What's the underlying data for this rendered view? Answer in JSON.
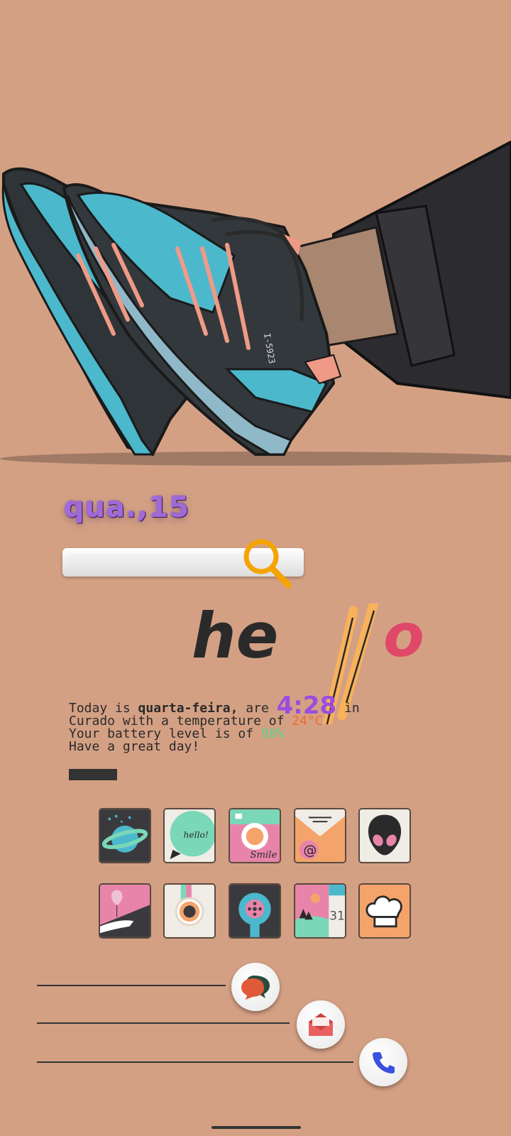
{
  "date_widget": {
    "text": "qua.,15"
  },
  "greeting": {
    "letters": "he",
    "tail": "o"
  },
  "info": {
    "line1_prefix": "Today is ",
    "weekday": "quarta-feira,",
    "line1_mid": " are ",
    "time": "4:28",
    "line1_suffix": " in",
    "line2_prefix": "Curado with a temperature of ",
    "temperature": "24°C",
    "line3_prefix": "Your battery level is of ",
    "battery": "98%",
    "line4": "Have a great day!"
  },
  "apps_row1": [
    {
      "icon": "planet-icon"
    },
    {
      "icon": "hello-chat-icon",
      "text": "hello!"
    },
    {
      "icon": "smile-camera-icon",
      "text": "Smile"
    },
    {
      "icon": "mail-at-icon",
      "text": "@"
    },
    {
      "icon": "alien-icon"
    }
  ],
  "apps_row2": [
    {
      "icon": "balloon-icon"
    },
    {
      "icon": "instant-camera-icon"
    },
    {
      "icon": "hairdryer-icon"
    },
    {
      "icon": "calendar-landscape-icon",
      "text": "31"
    },
    {
      "icon": "chef-hat-icon"
    }
  ],
  "dock": [
    {
      "icon": "chat-bubbles-icon"
    },
    {
      "icon": "envelope-icon"
    },
    {
      "icon": "phone-icon"
    }
  ],
  "colors": {
    "background": "#d4a084",
    "accent_purple": "#9a4de0",
    "temperature": "#f06a2a",
    "battery": "#5ccf8a",
    "hello_red": "#e0486a"
  }
}
